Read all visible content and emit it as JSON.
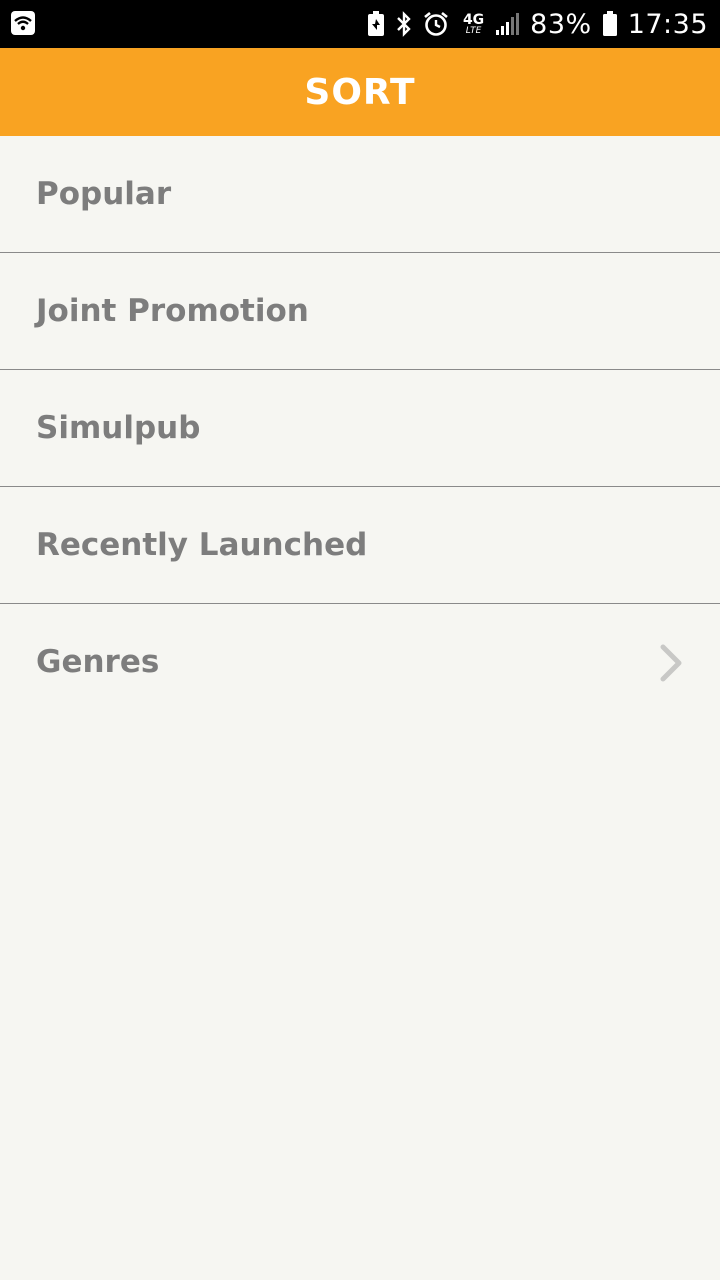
{
  "status_bar": {
    "battery_percent": "83%",
    "time": "17:35",
    "network": "4G",
    "network_sub": "LTE",
    "icons": [
      "wifi-icon",
      "battery-saver-icon",
      "bluetooth-icon",
      "alarm-icon",
      "network-4g-icon",
      "signal-icon",
      "battery-icon"
    ]
  },
  "header": {
    "title": "SORT",
    "color": "#f9a322"
  },
  "sort_options": [
    {
      "label": "Popular"
    },
    {
      "label": "Joint Promotion"
    },
    {
      "label": "Simulpub"
    },
    {
      "label": "Recently Launched"
    },
    {
      "label": "Genres",
      "has_submenu": true
    }
  ]
}
